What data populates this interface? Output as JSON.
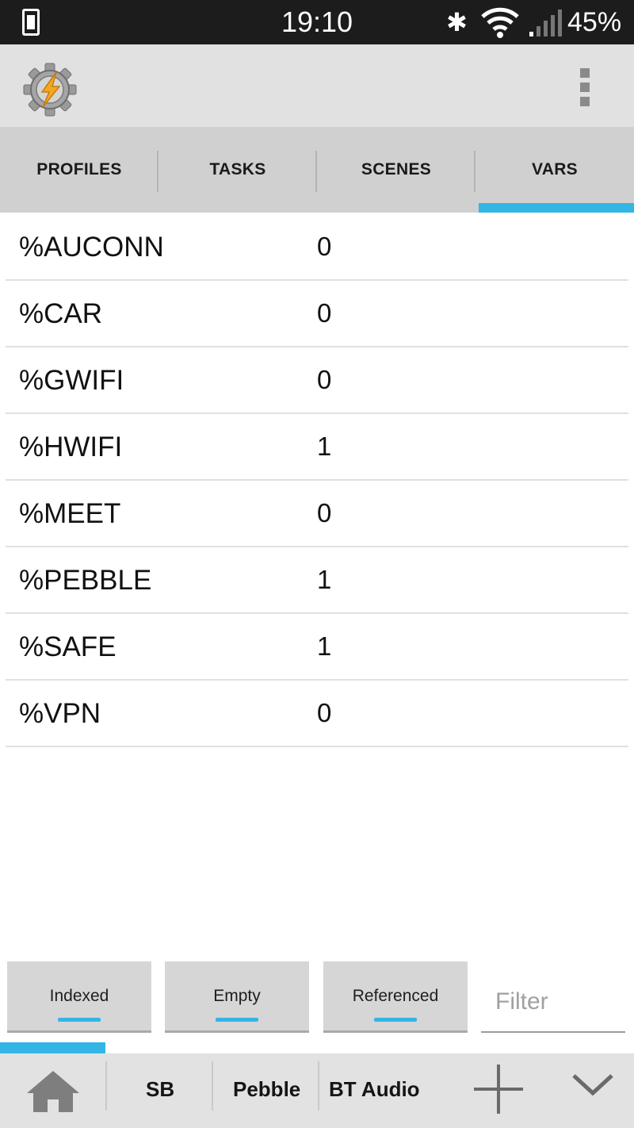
{
  "status_bar": {
    "time": "19:10",
    "battery": "45%",
    "icons": [
      "phone-icon",
      "bluetooth-icon",
      "wifi-icon",
      "signal-icon"
    ]
  },
  "action_bar": {
    "logo_icon": "tasker-gear-bolt-icon",
    "overflow_icon": "overflow-menu-icon"
  },
  "tabs": [
    {
      "label": "PROFILES",
      "active": false
    },
    {
      "label": "TASKS",
      "active": false
    },
    {
      "label": "SCENES",
      "active": false
    },
    {
      "label": "VARS",
      "active": true
    }
  ],
  "variables": [
    {
      "name": "%AUCONN",
      "value": "0"
    },
    {
      "name": "%CAR",
      "value": "0"
    },
    {
      "name": "%GWIFI",
      "value": "0"
    },
    {
      "name": "%HWIFI",
      "value": "1"
    },
    {
      "name": "%MEET",
      "value": "0"
    },
    {
      "name": "%PEBBLE",
      "value": "1"
    },
    {
      "name": "%SAFE",
      "value": "1"
    },
    {
      "name": "%VPN",
      "value": "0"
    }
  ],
  "filters": {
    "indexed_label": "Indexed",
    "empty_label": "Empty",
    "referenced_label": "Referenced",
    "filter_placeholder": "Filter"
  },
  "bottom_bar": {
    "home_icon": "home-icon",
    "projects": [
      "SB",
      "Pebble",
      "BT Audio"
    ],
    "add_icon": "plus-icon",
    "more_icon": "chevron-down-icon"
  },
  "colors": {
    "accent": "#33b5e5",
    "status_bar": "#1c1c1c",
    "action_bar": "#e1e1e1",
    "tab_bar": "#d0d0d0"
  }
}
